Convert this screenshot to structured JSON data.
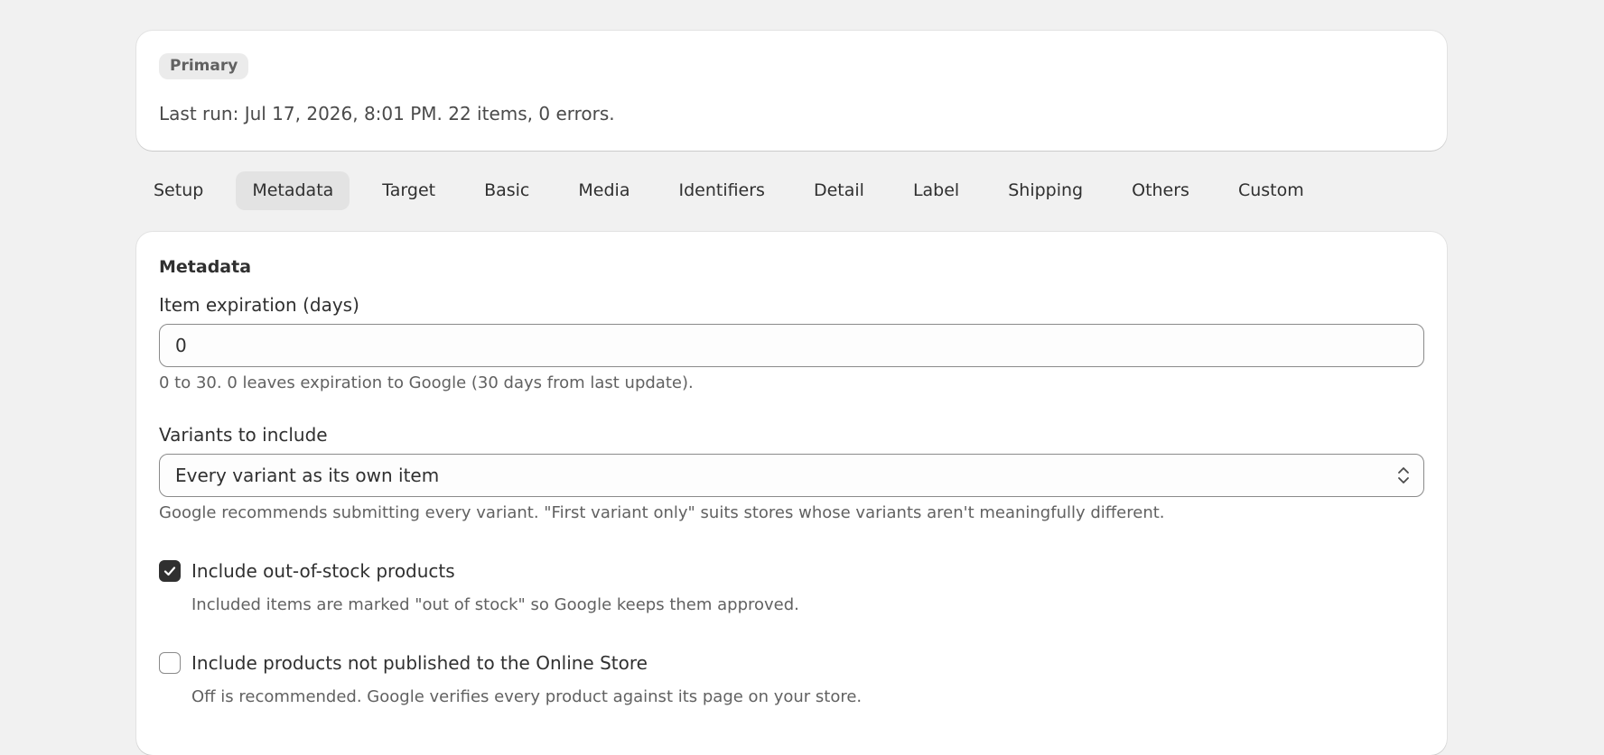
{
  "status": {
    "badge": "Primary",
    "last_run": "Last run: Jul 17, 2026, 8:01 PM. 22 items, 0 errors."
  },
  "tabs": [
    {
      "label": "Setup",
      "active": false
    },
    {
      "label": "Metadata",
      "active": true
    },
    {
      "label": "Target",
      "active": false
    },
    {
      "label": "Basic",
      "active": false
    },
    {
      "label": "Media",
      "active": false
    },
    {
      "label": "Identifiers",
      "active": false
    },
    {
      "label": "Detail",
      "active": false
    },
    {
      "label": "Label",
      "active": false
    },
    {
      "label": "Shipping",
      "active": false
    },
    {
      "label": "Others",
      "active": false
    },
    {
      "label": "Custom",
      "active": false
    }
  ],
  "metadata": {
    "title": "Metadata",
    "expiration": {
      "label": "Item expiration (days)",
      "value": "0",
      "help": "0 to 30. 0 leaves expiration to Google (30 days from last update)."
    },
    "variants": {
      "label": "Variants to include",
      "value": "Every variant as its own item",
      "help": "Google recommends submitting every variant. \"First variant only\" suits stores whose variants aren't meaningfully different."
    },
    "out_of_stock": {
      "label": "Include out-of-stock products",
      "checked": true,
      "help": "Included items are marked \"out of stock\" so Google keeps them approved."
    },
    "unpublished": {
      "label": "Include products not published to the Online Store",
      "checked": false,
      "help": "Off is recommended. Google verifies every product against its page on your store."
    }
  },
  "icons": {
    "checkmark": "checkmark-icon",
    "select_chevron": "chevron-up-down-icon"
  },
  "colors": {
    "background": "#f1f1f1",
    "card": "#ffffff",
    "active_tab": "#e3e3e3",
    "checkbox_checked": "#303030"
  }
}
